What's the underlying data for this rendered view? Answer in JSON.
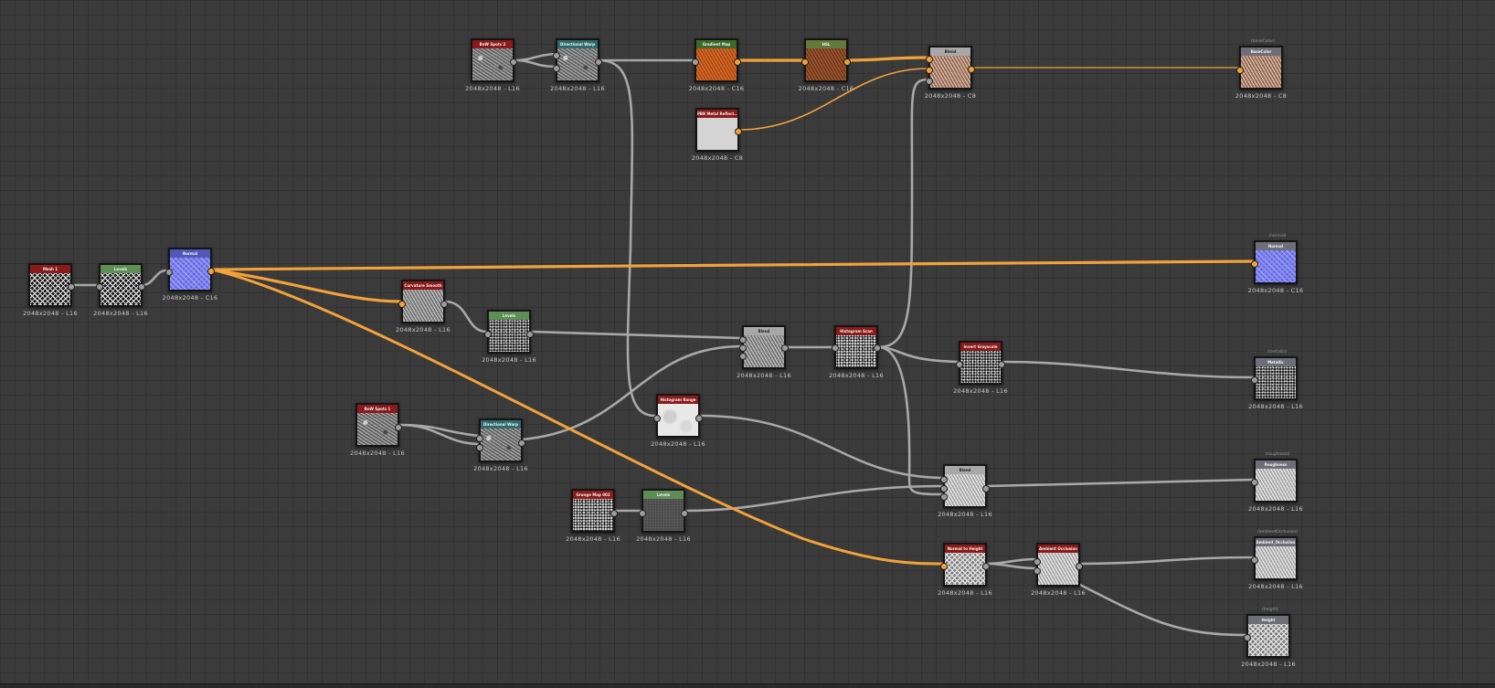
{
  "colors": {
    "header_red": "#8b1a1a",
    "header_green": "#5e8d55",
    "header_teal": "#2e6a6e",
    "header_darkgreen": "#3a6b2a",
    "header_olive": "#607a3a",
    "header_gray": "#a8a8a8",
    "header_output": "#6e6e78",
    "header_normal": "#5258b8",
    "wire_gray": "#a8a8a8",
    "wire_orange": "#f2a23a"
  },
  "nodes": [
    {
      "id": "n_mesh1",
      "title": "Mesh 1",
      "res": "2048x2048 - L16",
      "header": "header_red",
      "thumb": "checker"
    },
    {
      "id": "n_levels1",
      "title": "Levels",
      "res": "2048x2048 - L16",
      "header": "header_green",
      "thumb": "checker"
    },
    {
      "id": "n_normal",
      "title": "Normal",
      "res": "2048x2048 - C16",
      "header": "header_normal",
      "thumb": "normal"
    },
    {
      "id": "n_bnw2",
      "title": "BnW Spots 2",
      "res": "2048x2048 - L16",
      "header": "header_red",
      "thumb": "noise"
    },
    {
      "id": "n_dirwarp1",
      "title": "Directional Warp",
      "res": "2048x2048 - L16",
      "header": "header_teal",
      "thumb": "noise"
    },
    {
      "id": "n_gradmap",
      "title": "Gradient Map",
      "res": "2048x2048 - C16",
      "header": "header_darkgreen",
      "thumb": "orange"
    },
    {
      "id": "n_hsl",
      "title": "HSL",
      "res": "2048x2048 - C16",
      "header": "header_olive",
      "thumb": "brown"
    },
    {
      "id": "n_pbr",
      "title": "PBR Metal Reflect...",
      "res": "2048x2048 - C8",
      "header": "header_red",
      "thumb": "lightgray"
    },
    {
      "id": "n_blend1",
      "title": "Blend",
      "res": "2048x2048 - C8",
      "header": "header_gray",
      "thumb": "brownlight"
    },
    {
      "id": "n_basecolor",
      "title": "BaseColor",
      "res": "2048x2048 - C8",
      "header": "header_output",
      "thumb": "brownlight",
      "output_label": "(baseColor)"
    },
    {
      "id": "n_out_normal",
      "title": "Normal",
      "res": "2048x2048 - C16",
      "header": "header_output",
      "thumb": "normal",
      "output_label": "(normal)"
    },
    {
      "id": "n_curv",
      "title": "Curvature Smooth",
      "res": "2048x2048 - L16",
      "header": "header_red",
      "thumb": "grain"
    },
    {
      "id": "n_levels2",
      "title": "Levels",
      "res": "2048x2048 - L16",
      "header": "header_green",
      "thumb": "speckle_dark"
    },
    {
      "id": "n_blend2",
      "title": "Blend",
      "res": "2048x2048 - L16",
      "header": "header_gray",
      "thumb": "grain"
    },
    {
      "id": "n_histscan",
      "title": "Histogram Scan",
      "res": "2048x2048 - L16",
      "header": "header_red",
      "thumb": "speckle_light"
    },
    {
      "id": "n_invgray",
      "title": "Invert Grayscale",
      "res": "2048x2048 - L16",
      "header": "header_red",
      "thumb": "speckle_dark"
    },
    {
      "id": "n_metallic",
      "title": "Metallic",
      "res": "2048x2048 - L16",
      "header": "header_output",
      "thumb": "speckle_dark",
      "output_label": "(metallic)"
    },
    {
      "id": "n_bnw1",
      "title": "BnW Spots 1",
      "res": "2048x2048 - L16",
      "header": "header_red",
      "thumb": "noise"
    },
    {
      "id": "n_dirwarp2",
      "title": "Directional Warp",
      "res": "2048x2048 - L16",
      "header": "header_teal",
      "thumb": "noise"
    },
    {
      "id": "n_histrange",
      "title": "Histogram Range",
      "res": "2048x2048 - L16",
      "header": "header_red",
      "thumb": "white_soft"
    },
    {
      "id": "n_grunge",
      "title": "Grunge Map 002",
      "res": "2048x2048 - L16",
      "header": "header_red",
      "thumb": "speckle_light"
    },
    {
      "id": "n_levels3",
      "title": "Levels",
      "res": "2048x2048 - L16",
      "header": "header_green",
      "thumb": "darkgray"
    },
    {
      "id": "n_blend3",
      "title": "Blend",
      "res": "2048x2048 - L16",
      "header": "header_gray",
      "thumb": "grain_light"
    },
    {
      "id": "n_roughness",
      "title": "Roughness",
      "res": "2048x2048 - L16",
      "header": "header_output",
      "thumb": "grain_light",
      "output_label": "(roughness)"
    },
    {
      "id": "n_n2h",
      "title": "Normal to Height",
      "res": "2048x2048 - L16",
      "header": "header_red",
      "thumb": "checker_light"
    },
    {
      "id": "n_ao",
      "title": "Ambient Occlusion",
      "res": "2048x2048 - L16",
      "header": "header_red",
      "thumb": "grain_light"
    },
    {
      "id": "n_out_ao",
      "title": "Ambient_Occlusion",
      "res": "2048x2048 - L16",
      "header": "header_output",
      "thumb": "grain_light",
      "output_label": "(ambientOcclusion)"
    },
    {
      "id": "n_height",
      "title": "Height",
      "res": "2048x2048 - L16",
      "header": "header_output",
      "thumb": "checker_light",
      "output_label": "(height)"
    }
  ]
}
